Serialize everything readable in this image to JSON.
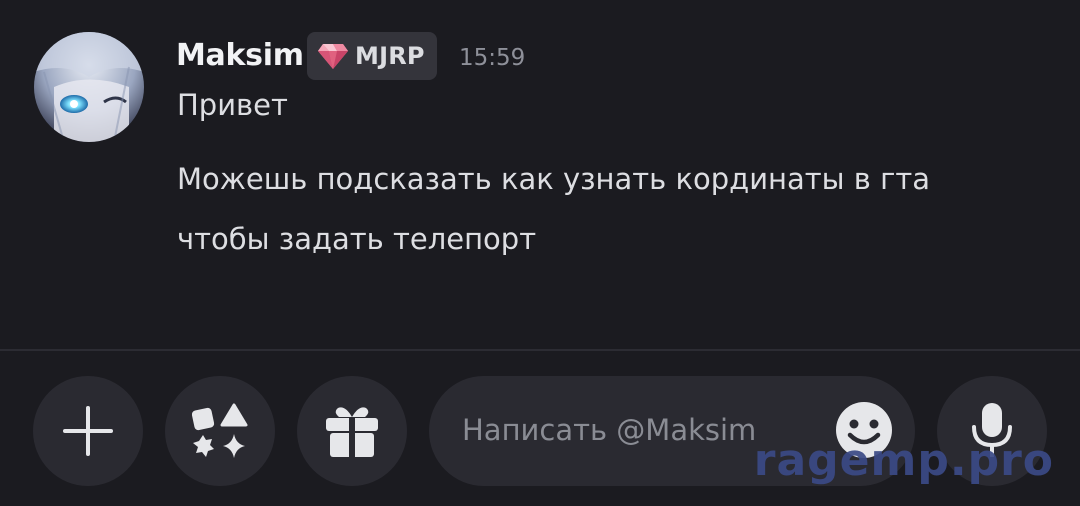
{
  "message": {
    "author": "Maksim",
    "tag": "MJRP",
    "timestamp": "15:59",
    "lines": [
      "Привет",
      "Можешь подсказать как узнать кординаты в гта",
      "чтобы задать телепорт"
    ]
  },
  "composer": {
    "placeholder": "Написать @Maksim",
    "buttons": {
      "add": "plus-icon",
      "apps": "apps-icon",
      "gift": "gift-icon",
      "emoji": "smiley-icon",
      "voice": "microphone-icon"
    }
  },
  "watermark": "ragemp.pro",
  "colors": {
    "background": "#1b1b20",
    "surface": "#2a2a31",
    "tag_background": "#34343b",
    "gem": "#e8738f",
    "watermark": "#3b4a86"
  }
}
